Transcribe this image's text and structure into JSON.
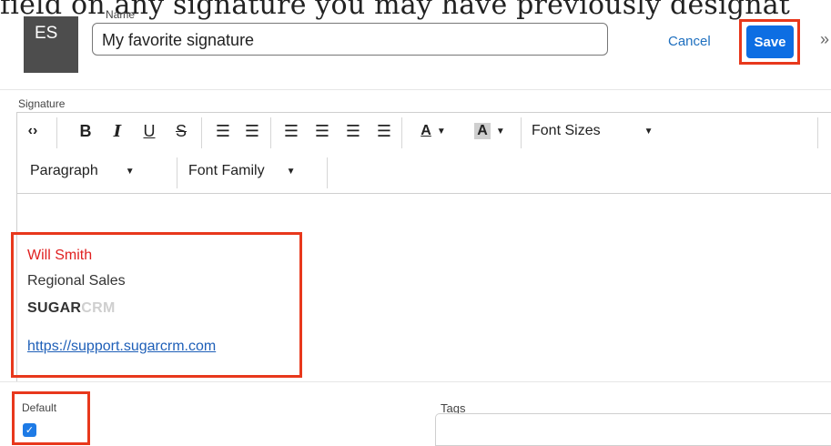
{
  "doc": {
    "clipped_text": "field on any signature you may have previously designat"
  },
  "header": {
    "avatar_initials": "ES",
    "name_label": "Name",
    "name_value": "My favorite signature",
    "cancel_label": "Cancel",
    "save_label": "Save",
    "more_icon": "»"
  },
  "signature": {
    "label": "Signature",
    "toolbar": {
      "code_icon": "‹›",
      "bold": "B",
      "italic": "I",
      "underline": "U",
      "strike": "S",
      "bullets_icon": "☰",
      "numbers_icon": "☰",
      "align_left_icon": "☰",
      "align_center_icon": "☰",
      "align_right_icon": "☰",
      "justify_icon": "☰",
      "text_color": "A",
      "bg_color": "A",
      "font_sizes": "Font Sizes",
      "paragraph": "Paragraph",
      "font_family": "Font Family"
    },
    "content": {
      "name": "Will Smith",
      "title": "Regional Sales",
      "logo_bold": "SUGAR",
      "logo_light": "CRM",
      "link": "https://support.sugarcrm.com"
    }
  },
  "fields": {
    "default_label": "Default",
    "default_checked": true,
    "tags_label": "Tags",
    "tags_value": ""
  },
  "colors": {
    "accent": "#0d6ee3",
    "highlight": "#e8381c",
    "signature_name": "#e02020"
  }
}
